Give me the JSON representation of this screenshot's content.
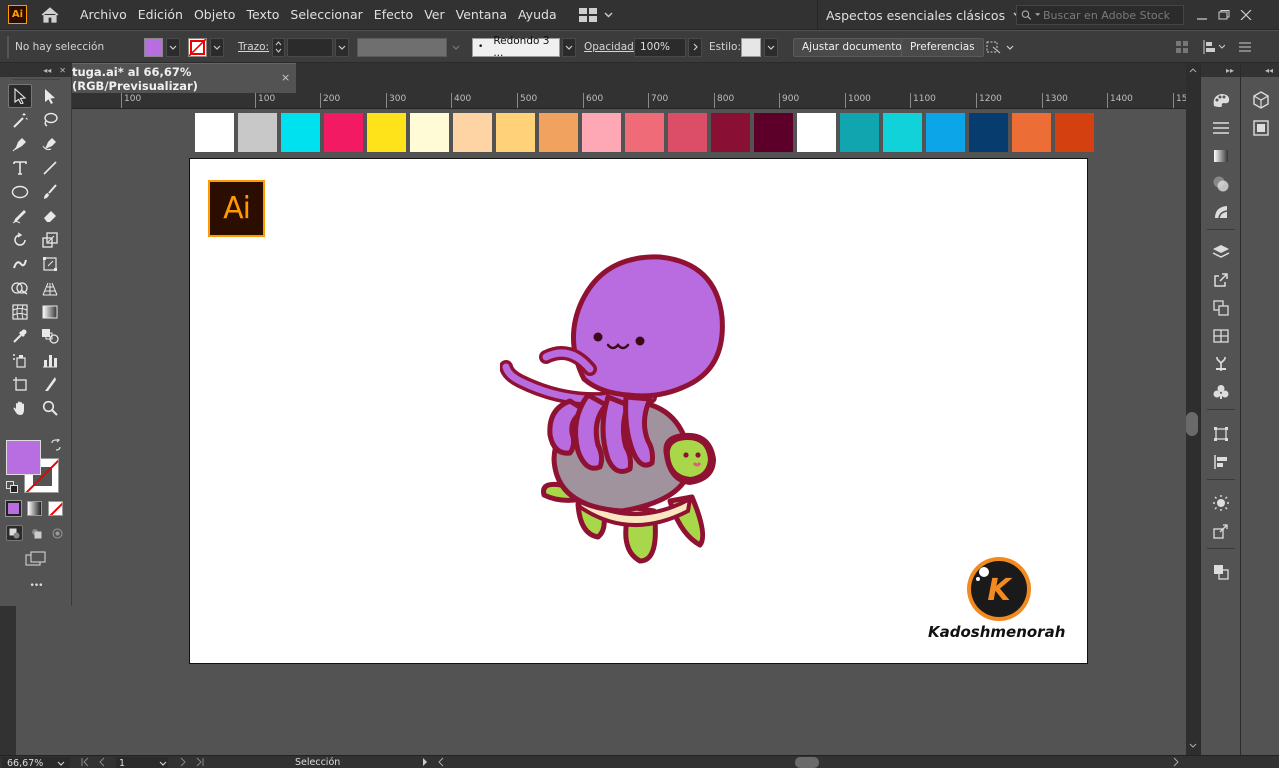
{
  "app": {
    "logo_text": "Ai"
  },
  "menu": [
    "Archivo",
    "Edición",
    "Objeto",
    "Texto",
    "Seleccionar",
    "Efecto",
    "Ver",
    "Ventana",
    "Ayuda"
  ],
  "workspace": {
    "name": "Aspectos esenciales clásicos"
  },
  "stock_search": {
    "placeholder": "Buscar en Adobe Stock"
  },
  "control": {
    "selection_status": "No hay selección",
    "fill_color": "#b86ee0",
    "stroke_label": "Trazo:",
    "brush_value": "Redondo 3 ...",
    "opacity_label": "Opacidad:",
    "opacity_value": "100%",
    "style_label": "Estilo:",
    "adjust_button": "Ajustar documento",
    "preferences_button": "Preferencias"
  },
  "document_tab": {
    "title": "tuga.ai* al 66,67% (RGB/Previsualizar)",
    "close": "×"
  },
  "ruler": {
    "labels": [
      "100",
      "100",
      "200",
      "300",
      "400",
      "500",
      "600",
      "700",
      "800",
      "900",
      "1000",
      "1100",
      "1200",
      "1300",
      "1400",
      "15"
    ]
  },
  "swatches": [
    "#ffffff",
    "#c8c8c8",
    "#00e1f0",
    "#f21a63",
    "#ffe31a",
    "#fffbd6",
    "#ffd4a5",
    "#ffd27a",
    "#f0a25e",
    "#ffa8b5",
    "#ef6b78",
    "#dc4d68",
    "#8a0f35",
    "#5c002a",
    "#ffffff",
    "#11a5b0",
    "#12d2d9",
    "#0ba5e8",
    "#073d6e",
    "#ec6d35",
    "#d44010"
  ],
  "artboard": {
    "badge_text": "Ai",
    "brand_letter": "K",
    "brand_name": "Kadoshmenorah"
  },
  "tools_panel": {
    "more": "•••"
  },
  "status": {
    "zoom": "66,67%",
    "page": "1",
    "tool": "Selección"
  },
  "colors": {
    "accent": "#ff9a00",
    "fill": "#b86ee0",
    "octopus": "#b96be0",
    "outline": "#8f1233",
    "shell": "#a0939e",
    "turtle": "#a8d84a"
  }
}
